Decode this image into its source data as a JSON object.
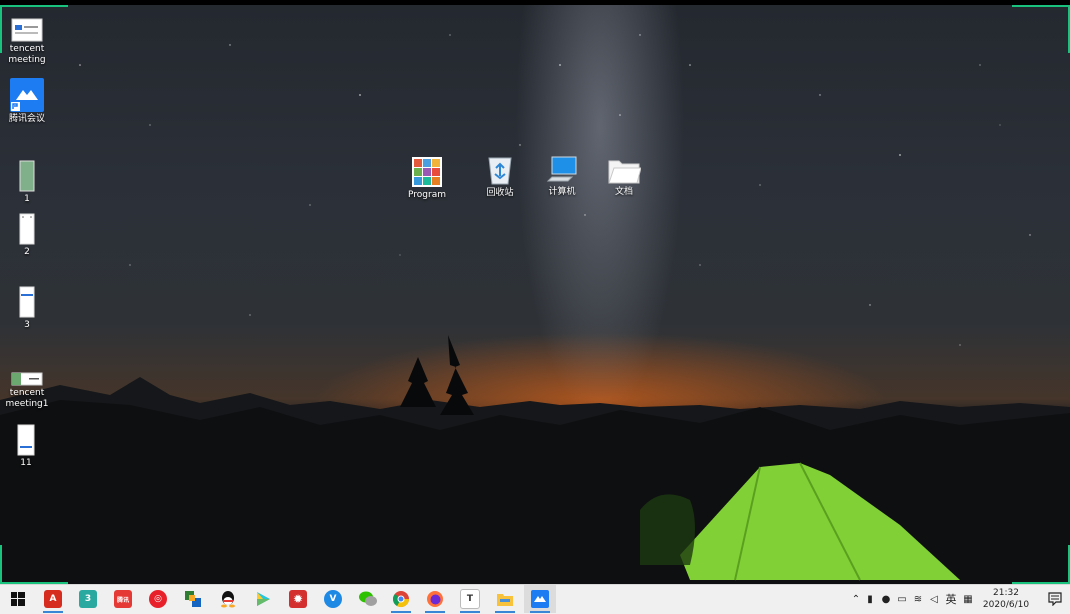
{
  "desktop": {
    "left_icons": [
      {
        "label_line1": "tencent",
        "label_line2": "meeting"
      },
      {
        "label_line1": "腾讯会议",
        "label_line2": ""
      },
      {
        "label_line1": "1",
        "label_line2": ""
      },
      {
        "label_line1": "2",
        "label_line2": ""
      },
      {
        "label_line1": "3",
        "label_line2": ""
      },
      {
        "label_line1": "tencent",
        "label_line2": "meeting1"
      },
      {
        "label_line1": "11",
        "label_line2": ""
      }
    ],
    "center_icons": [
      {
        "label": "Program"
      },
      {
        "label": "回收站"
      },
      {
        "label": "计算机"
      },
      {
        "label": "文档"
      }
    ]
  },
  "taskbar": {
    "ime": "英",
    "time": "21:32",
    "date": "2020/6/10",
    "apps": [
      {
        "icon": "start-icon"
      },
      {
        "icon": "acrobat-icon"
      },
      {
        "icon": "app-3-icon"
      },
      {
        "icon": "app-red-icon"
      },
      {
        "icon": "netease-music-icon"
      },
      {
        "icon": "multi-window-icon"
      },
      {
        "icon": "qq-icon"
      },
      {
        "icon": "play-icon"
      },
      {
        "icon": "settings-red-icon"
      },
      {
        "icon": "v-app-icon"
      },
      {
        "icon": "wechat-icon"
      },
      {
        "icon": "chrome-icon"
      },
      {
        "icon": "firefox-icon"
      },
      {
        "icon": "text-t-icon"
      },
      {
        "icon": "file-explorer-icon"
      },
      {
        "icon": "tencent-meeting-icon"
      }
    ],
    "app_badge": "3",
    "app_red_text": "腾讯",
    "text_t": "T"
  },
  "colors": {
    "accent_green": "#19c37d",
    "taskbar_bg": "#f0f0f0",
    "tent_green": "#8ee63a"
  }
}
